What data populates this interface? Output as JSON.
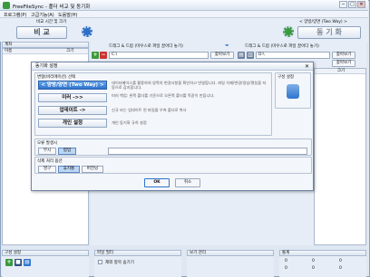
{
  "window": {
    "title": "FreeFileSync - 폴더 비교 및 동기화",
    "controls": [
      "─",
      "□",
      "✕"
    ]
  },
  "menu": [
    "프로그램(P)",
    "고급기능(A)",
    "도움말(H)"
  ],
  "toolbar": {
    "compare_label": "비 교",
    "compare_caption": "비교 시간 및 크기",
    "sync_label": "동 기 화",
    "sync_caption": "< 양방/양면 (Two Way) >"
  },
  "left_panel": {
    "header": "계좌",
    "columns": [
      "이름",
      "크기"
    ]
  },
  "folder_pair": {
    "left_label": "드래그 & 드랍 (마우스로 파일 끌어다 놓기)",
    "left_path": "C:\\",
    "left_browse": "찾아보기",
    "right_label": "드래그 & 드랍 (마우스로 파일 끌어다 놓기)",
    "right_path": "D:\\",
    "right_browse": "찾아보기",
    "right_browse2": "찾아보기",
    "right_col": "크기"
  },
  "dialog": {
    "title": "동기화 설정",
    "variant_label": "변형(바리에이션) 선택",
    "options": [
      {
        "label": "< 양방/양면 (Two Way) >",
        "desc": "데이터베이스를 활용하여 양쪽의 변경사항을 확인하고 반영합니다. 파일 삭제/변경/생성/명칭을 자동으로 감지합니다."
      },
      {
        "label": "미러 ->>",
        "desc": "미러 백업: 왼쪽 폴더를 기준으로 오른쪽 폴더를 똑같이 만듭니다."
      },
      {
        "label": "업데이트 ->",
        "desc": "신규 또는 업데이트 된 파일을 우측 폴더로 복사"
      },
      {
        "label": "개인 설정",
        "desc": "개인 동기화 규칙 설정"
      }
    ],
    "config_label": "구성 설정",
    "error_label": "오류 발생시",
    "error_opts": [
      "무시",
      "팝업"
    ],
    "delete_label": "삭제 처리 옵션",
    "delete_opts": [
      "영구",
      "휴지통",
      "버전닝"
    ],
    "ok": "OK",
    "cancel": "취소"
  },
  "bottom": {
    "config_title": "구성 설정",
    "filter_title": "파일 필터",
    "filter_check": "제외 항목 숨기기",
    "view_title": "보기 관리",
    "stats_title": "통계",
    "stats_values": [
      "0",
      "0",
      "0",
      "0",
      "0",
      "0"
    ]
  },
  "colors": {
    "accent": "#2f74cf",
    "green": "#3b9a3b"
  }
}
